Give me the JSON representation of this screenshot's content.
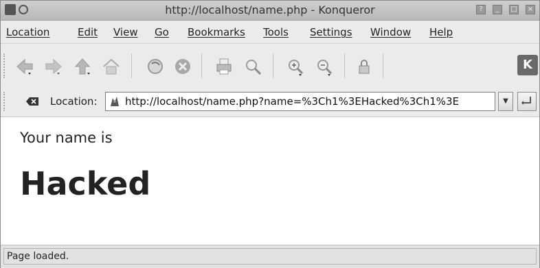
{
  "window": {
    "title": "http://localhost/name.php - Konqueror"
  },
  "menubar": {
    "items": [
      "Location",
      "Edit",
      "View",
      "Go",
      "Bookmarks",
      "Tools",
      "Settings",
      "Window",
      "Help"
    ]
  },
  "toolbar": {
    "buttons": [
      "back-icon",
      "forward-icon",
      "up-icon",
      "home-icon",
      "reload-icon",
      "stop-icon",
      "print-icon",
      "find-icon",
      "zoom-in-icon",
      "zoom-out-icon",
      "security-icon"
    ],
    "logo": "K"
  },
  "location": {
    "label": "Location:",
    "url": "http://localhost/name.php?name=%3Ch1%3EHacked%3Ch1%3E"
  },
  "page": {
    "intro": "Your name is",
    "headline": "Hacked"
  },
  "status": {
    "text": "Page loaded."
  }
}
